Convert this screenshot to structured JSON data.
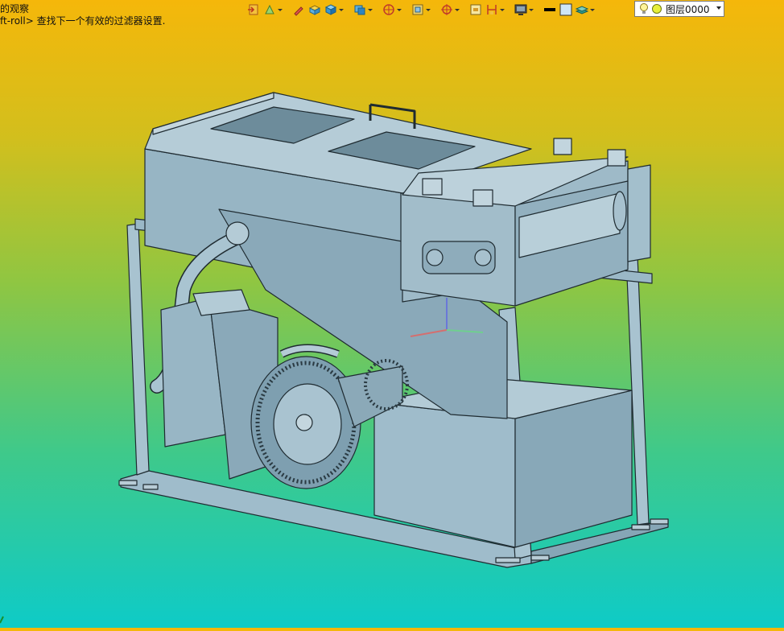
{
  "status": {
    "line1": "的观察",
    "line2": "ft-roll> 查找下一个有效的过滤器设置."
  },
  "toolbar": {
    "buttons": [
      {
        "icon": "exit-sketch-icon",
        "dropdown": false
      },
      {
        "icon": "snap-filter-icon",
        "dropdown": true
      },
      {
        "icon": "pencil-icon",
        "dropdown": false
      },
      {
        "icon": "box-face-icon",
        "dropdown": false
      },
      {
        "icon": "solid-box-icon",
        "dropdown": true
      },
      {
        "icon": "display-style-icon",
        "dropdown": true
      },
      {
        "icon": "section-view-icon",
        "dropdown": true
      },
      {
        "icon": "view-orientation-icon",
        "dropdown": true
      },
      {
        "icon": "pan-crosshair-icon",
        "dropdown": true
      },
      {
        "icon": "fit-view-icon",
        "dropdown": false
      },
      {
        "icon": "dimension-icon",
        "dropdown": true
      },
      {
        "icon": "monitor-icon",
        "dropdown": true
      },
      {
        "icon": "line-color-icon",
        "dropdown": false
      },
      {
        "icon": "fill-color-icon",
        "dropdown": false
      },
      {
        "icon": "layer-manager-icon",
        "dropdown": true
      }
    ],
    "layer": {
      "value": "图层0000",
      "icons": [
        "lightbulb-icon",
        "layer-visible-icon"
      ]
    }
  },
  "colors": {
    "gradient_top": "#f5b70a",
    "gradient_bottom": "#0ecbc7",
    "model_fill": "#8fb0bf",
    "model_edge": "#1e2a30"
  }
}
